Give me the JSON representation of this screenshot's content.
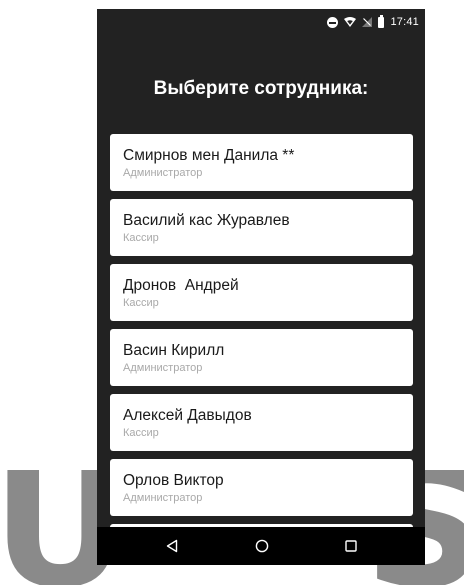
{
  "watermark": {
    "letter_left": "U",
    "letter_right": "S"
  },
  "status_bar": {
    "time": "17:41",
    "icons": [
      "do-not-disturb-icon",
      "wifi-icon",
      "signal-icon",
      "battery-icon"
    ]
  },
  "screen": {
    "title": "Выберите сотрудника:"
  },
  "employees": [
    {
      "name": "Смирнов мен Данила **",
      "role": "Администратор"
    },
    {
      "name": "Василий кас Журавлев",
      "role": "Кассир"
    },
    {
      "name": "Дронов  Андрей",
      "role": "Кассир"
    },
    {
      "name": "Васин Кирилл",
      "role": "Администратор"
    },
    {
      "name": "Алексей Давыдов",
      "role": "Кассир"
    },
    {
      "name": "Орлов Виктор",
      "role": "Администратор"
    }
  ],
  "nav_bar": {
    "icons": [
      "back-icon",
      "home-icon",
      "recents-icon"
    ]
  },
  "colors": {
    "background": "#222222",
    "card": "#ffffff",
    "name_text": "#1a1a1a",
    "role_text": "#a9a9a9",
    "watermark": "#8a8a8a"
  }
}
